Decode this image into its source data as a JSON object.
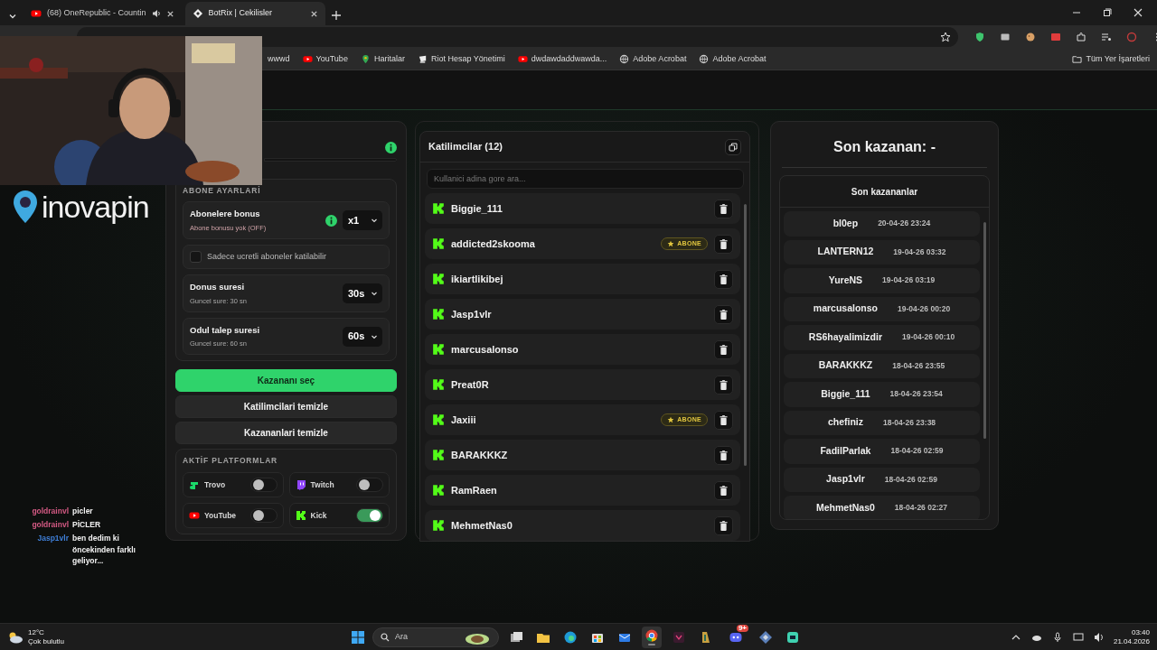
{
  "browser": {
    "tabs": [
      {
        "title": "(68) OneRepublic - Countin",
        "selected": false,
        "kind": "youtube",
        "audio": true
      },
      {
        "title": "BotRix | Cekilisler",
        "selected": true,
        "kind": "botrix",
        "audio": false
      }
    ],
    "bookmarks": [
      {
        "label": "wwwd",
        "kind": "none"
      },
      {
        "label": "YouTube",
        "kind": "youtube"
      },
      {
        "label": "Haritalar",
        "kind": "maps"
      },
      {
        "label": "Riot Hesap Yönetimi",
        "kind": "riot"
      },
      {
        "label": "dwdawdaddwawda...",
        "kind": "youtube"
      },
      {
        "label": "Adobe Acrobat",
        "kind": "globe"
      },
      {
        "label": "Adobe Acrobat",
        "kind": "globe"
      }
    ],
    "all_bookmarks": "Tüm Yer İşaretleri"
  },
  "overlay": {
    "logo": "inovapin",
    "chat": [
      {
        "user": "goldrainvl",
        "color": "#d45a84",
        "message": "picler"
      },
      {
        "user": "goldrainvl",
        "color": "#d45a84",
        "message": "PİCLER"
      },
      {
        "user": "Jasp1vlr",
        "color": "#3f7fd8",
        "message": "ben dedim ki öncekinden farklı geliyor..."
      }
    ]
  },
  "settings": {
    "section_title": "ABONE AYARLARİ",
    "bonus": {
      "label": "Abonelere bonus",
      "hint": "Abone bonusu yok (OFF)",
      "value": "x1"
    },
    "paid_only": {
      "label": "Sadece ucretli aboneler katilabilir",
      "checked": false
    },
    "timers": [
      {
        "label": "Donus suresi",
        "hint": "Guncel sure: 30 sn",
        "value": "30s"
      },
      {
        "label": "Odul talep suresi",
        "hint": "Guncel sure: 60 sn",
        "value": "60s"
      }
    ]
  },
  "actions": [
    {
      "label": "Kazananı seç",
      "kind": "primary"
    },
    {
      "label": "Katilimcilari temizle",
      "kind": "secondary"
    },
    {
      "label": "Kazananlari temizle",
      "kind": "secondary"
    }
  ],
  "platforms": {
    "title": "AKTİF PLATFORMLAR",
    "items": [
      {
        "name": "Trovo",
        "kind": "trovo",
        "on": false
      },
      {
        "name": "Twitch",
        "kind": "twitch",
        "on": false
      },
      {
        "name": "YouTube",
        "kind": "youtube",
        "on": false
      },
      {
        "name": "Kick",
        "kind": "kick",
        "on": true
      }
    ]
  },
  "participants": {
    "title": "Katilimcilar (12)",
    "search_placeholder": "Kullanici adina gore ara...",
    "rows": [
      {
        "name": "Biggie_111"
      },
      {
        "name": "addicted2skooma",
        "badge": "ABONE"
      },
      {
        "name": "ikiartlikibej"
      },
      {
        "name": "Jasp1vlr"
      },
      {
        "name": "marcusalonso"
      },
      {
        "name": "Preat0R"
      },
      {
        "name": "Jaxiii",
        "badge": "ABONE"
      },
      {
        "name": "BARAKKKZ"
      },
      {
        "name": "RamRaen"
      },
      {
        "name": "MehmetNas0"
      }
    ]
  },
  "winners": {
    "last_winner": "Son kazanan: -",
    "title": "Son kazananlar",
    "rows": [
      {
        "name": "bl0ep",
        "time": "20-04-26 23:24"
      },
      {
        "name": "LANTERN12",
        "time": "19-04-26 03:32"
      },
      {
        "name": "YureNS",
        "time": "19-04-26 03:19"
      },
      {
        "name": "marcusalonso",
        "time": "19-04-26 00:20"
      },
      {
        "name": "RS6hayalimizdir",
        "time": "19-04-26 00:10"
      },
      {
        "name": "BARAKKKZ",
        "time": "18-04-26 23:55"
      },
      {
        "name": "Biggie_111",
        "time": "18-04-26 23:54"
      },
      {
        "name": "chefiniz",
        "time": "18-04-26 23:38"
      },
      {
        "name": "FadilParlak",
        "time": "18-04-26 02:59"
      },
      {
        "name": "Jasp1vlr",
        "time": "18-04-26 02:59"
      },
      {
        "name": "MehmetNas0",
        "time": "18-04-26 02:27"
      }
    ]
  },
  "taskbar": {
    "temperature": "12°C",
    "condition": "Çok bulutlu",
    "search_placeholder": "Ara",
    "apps": [
      {
        "kind": "taskview",
        "active": false
      },
      {
        "kind": "folder",
        "active": false
      },
      {
        "kind": "edge",
        "active": false
      },
      {
        "kind": "store",
        "active": false
      },
      {
        "kind": "mail",
        "active": false
      },
      {
        "kind": "chrome",
        "active": true
      },
      {
        "kind": "purple",
        "active": false
      },
      {
        "kind": "game",
        "active": false
      },
      {
        "kind": "discord",
        "active": false,
        "badge": "9+"
      },
      {
        "kind": "diamond",
        "active": false
      },
      {
        "kind": "teal",
        "active": false
      }
    ],
    "time": "03:40",
    "date": "21.04.2026"
  }
}
